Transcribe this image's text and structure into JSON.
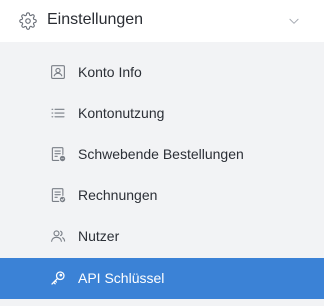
{
  "section": {
    "title": "Einstellungen",
    "icon": "gear-icon",
    "toggle_icon": "chevron-down-icon"
  },
  "items": [
    {
      "label": "Konto Info",
      "icon": "id-card-icon"
    },
    {
      "label": "Kontonutzung",
      "icon": "list-icon"
    },
    {
      "label": "Schwebende Bestellungen",
      "icon": "pending-document-icon"
    },
    {
      "label": "Rechnungen",
      "icon": "invoice-check-icon"
    },
    {
      "label": "Nutzer",
      "icon": "users-icon"
    },
    {
      "label": "API Schlüssel",
      "icon": "key-icon",
      "active": true
    }
  ],
  "colors": {
    "active_background": "#3b82d6",
    "submenu_background": "#f2f3f5",
    "text": "#2b2f36",
    "icon": "#7a7f87"
  }
}
